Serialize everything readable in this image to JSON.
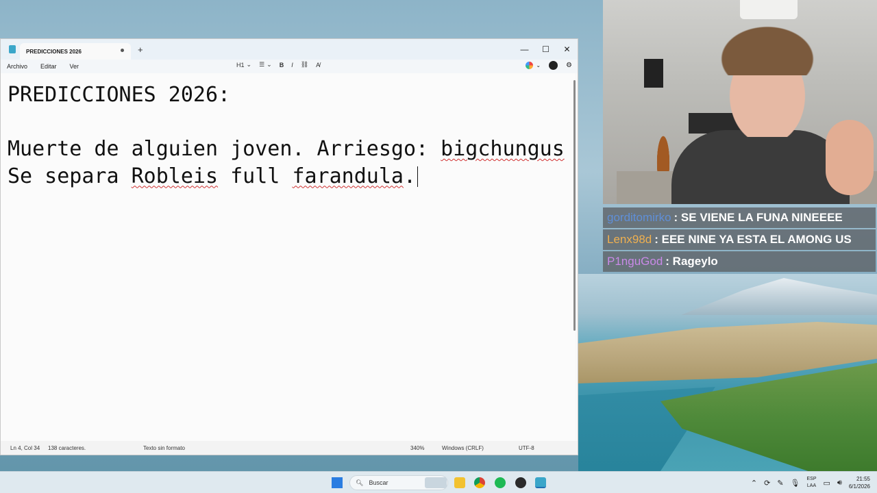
{
  "notepad": {
    "tab_title": "PREDICCIONES 2026",
    "new_tab_label": "+",
    "window_controls": {
      "minimize": "—",
      "maximize": "☐",
      "close": "✕"
    },
    "menu": [
      "Archivo",
      "Editar",
      "Ver"
    ],
    "toolbar": {
      "heading": "H1",
      "list_icon": "list-icon",
      "bold": "B",
      "italic": "I",
      "link_icon": "link-icon",
      "clear_format_icon": "clear-format-icon"
    },
    "content": {
      "line1": "PREDICCIONES 2026:",
      "line2": "",
      "line3_a": "Muerte de alguien joven. Arriesgo: ",
      "line3_b": "bigchungus",
      "line4_a": "Se separa ",
      "line4_b": "Robleis",
      "line4_c": " full ",
      "line4_d": "farandula",
      "line4_e": "."
    },
    "status": {
      "position": "Ln 4, Col 34",
      "chars": "138 caracteres.",
      "format": "Texto sin formato",
      "zoom": "340%",
      "line_ending": "Windows (CRLF)",
      "encoding": "UTF-8"
    }
  },
  "chat": [
    {
      "user": "gorditomirko",
      "color": "#5f8fd8",
      "message": ": SE VIENE LA FUNA NINEEEE"
    },
    {
      "user": "Lenx98d",
      "color": "#f0b050",
      "message": ": EEE NINE YA ESTA EL AMONG US"
    },
    {
      "user": "P1nguGod",
      "color": "#c98ae8",
      "message": ": Rageylo"
    }
  ],
  "taskbar": {
    "search_placeholder": "Buscar",
    "lang_top": "ESP",
    "lang_bottom": "LAA",
    "time": "21:55",
    "date": "6/1/2026"
  }
}
